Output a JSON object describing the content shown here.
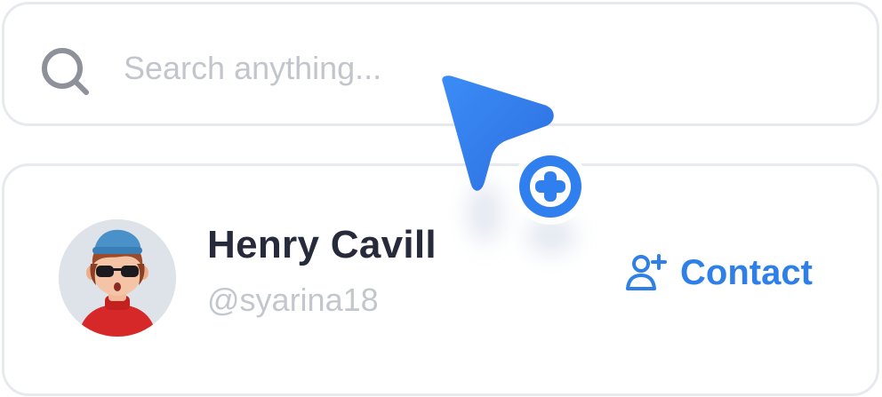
{
  "search": {
    "placeholder": "Search anything...",
    "value": ""
  },
  "contact": {
    "name": "Henry Cavill",
    "handle": "@syarina18",
    "action_label": "Contact"
  },
  "icons": {
    "search": "search-icon",
    "add_user": "user-plus-icon",
    "cursor": "pointer-cursor-icon",
    "plus": "plus-circle-icon",
    "avatar": "avatar"
  },
  "colors": {
    "accent": "#2e7fe8",
    "cursor": "#2f7fee",
    "name_text": "#262a3a",
    "muted_text": "#c3c7cd",
    "border": "#e6eaef"
  }
}
